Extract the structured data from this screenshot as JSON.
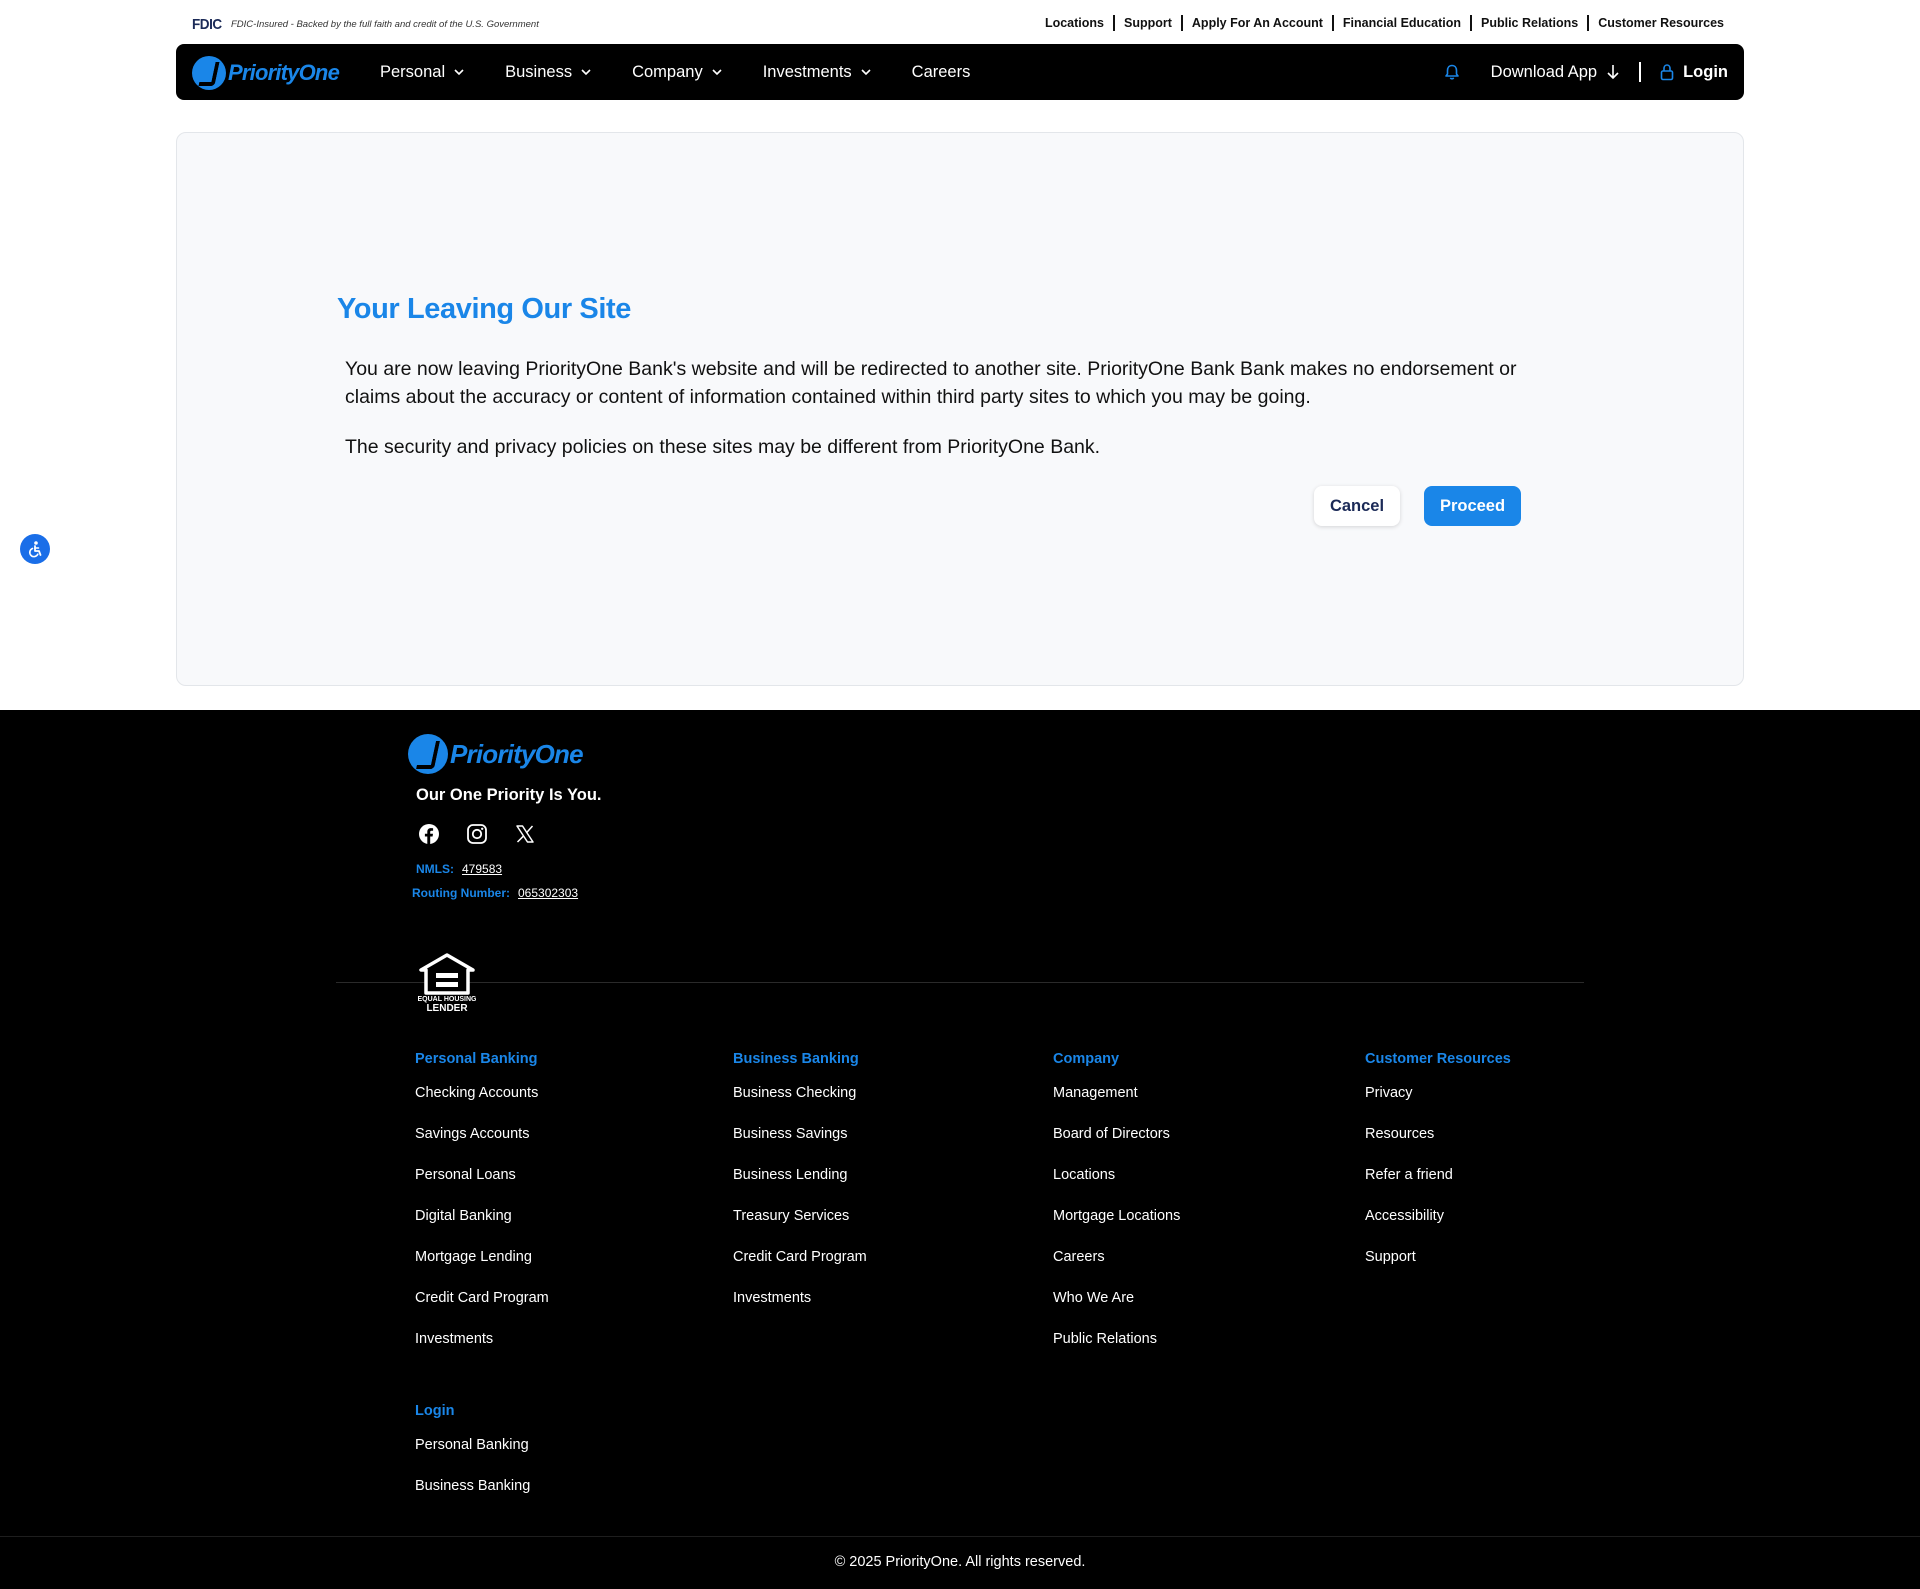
{
  "utility_bar": {
    "fdic_logo": "FDIC",
    "fdic_text": "FDIC-Insured - Backed by the full faith and credit of the U.S. Government",
    "links": [
      "Locations",
      "Support",
      "Apply For An Account",
      "Financial Education",
      "Public Relations",
      "Customer Resources"
    ]
  },
  "nav": {
    "brand": "PriorityOne",
    "items": [
      {
        "label": "Personal",
        "has_dropdown": true
      },
      {
        "label": "Business",
        "has_dropdown": true
      },
      {
        "label": "Company",
        "has_dropdown": true
      },
      {
        "label": "Investments",
        "has_dropdown": true
      },
      {
        "label": "Careers",
        "has_dropdown": false
      }
    ],
    "download_label": "Download App",
    "login_label": "Login",
    "icons": [
      "bell-icon",
      "arrow-down-icon",
      "lock-icon",
      "chevron-down-icon"
    ]
  },
  "modal": {
    "title": "Your Leaving Our Site",
    "paragraph1": "You are now leaving PriorityOne Bank's website and will be redirected to another site. PriorityOne Bank Bank makes no endorsement or claims about the accuracy or content of information contained within third party sites to which you may be going.",
    "paragraph2": "The security and privacy policies on these sites may be different from PriorityOne Bank.",
    "cancel_label": "Cancel",
    "proceed_label": "Proceed"
  },
  "footer": {
    "brand": "PriorityOne",
    "tagline": "Our One Priority Is You.",
    "nmls_label": "NMLS:",
    "nmls_value": "479583",
    "routing_label": "Routing Number:",
    "routing_value": "065302303",
    "equal_housing": "EQUAL HOUSING LENDER",
    "columns": [
      {
        "heading": "Personal Banking",
        "links": [
          "Checking Accounts",
          "Savings Accounts",
          "Personal Loans",
          "Digital Banking",
          "Mortgage Lending",
          "Credit Card Program",
          "Investments"
        ]
      },
      {
        "heading": "Business Banking",
        "links": [
          "Business Checking",
          "Business Savings",
          "Business Lending",
          "Treasury Services",
          "Credit Card Program",
          "Investments"
        ]
      },
      {
        "heading": "Company",
        "links": [
          "Management",
          "Board of Directors",
          "Locations",
          "Mortgage Locations",
          "Careers",
          "Who We Are",
          "Public Relations"
        ]
      },
      {
        "heading": "Customer Resources",
        "links": [
          "Privacy",
          "Resources",
          "Refer a friend",
          "Accessibility",
          "Support"
        ]
      },
      {
        "heading": "Login",
        "links": [
          "Personal Banking",
          "Business Banking"
        ]
      }
    ],
    "copyright": "© 2025 PriorityOne. All rights reserved."
  },
  "colors": {
    "accent": "#1a86e8",
    "nav_bg": "#000000",
    "card_bg": "#f8f9fb",
    "footer_bg": "#000000"
  }
}
